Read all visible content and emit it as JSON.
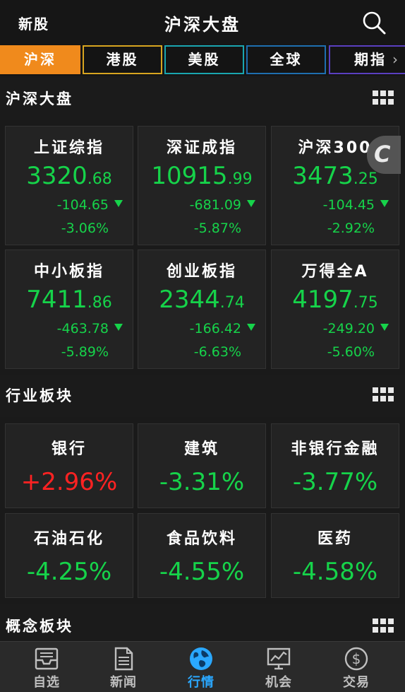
{
  "header": {
    "left": "新股",
    "title": "沪深大盘",
    "search_icon": "search-icon"
  },
  "tabs": [
    {
      "label": "沪深",
      "color": "#f08a1c",
      "active": true
    },
    {
      "label": "港股",
      "color": "#d8a520"
    },
    {
      "label": "美股",
      "color": "#1aa6b0"
    },
    {
      "label": "全球",
      "color": "#1e6fb0"
    },
    {
      "label": "期指",
      "color": "#5a3fc0"
    }
  ],
  "sections": {
    "index": "沪深大盘",
    "industry": "行业板块",
    "concept": "概念板块"
  },
  "indices": [
    {
      "name": "上证综指",
      "int": "3320",
      "dec": ".68",
      "chg": "-104.65",
      "pct": "-3.06%"
    },
    {
      "name": "深证成指",
      "int": "10915",
      "dec": ".99",
      "chg": "-681.09",
      "pct": "-5.87%"
    },
    {
      "name": "沪深300",
      "int": "3473",
      "dec": ".25",
      "chg": "-104.45",
      "pct": "-2.92%"
    },
    {
      "name": "中小板指",
      "int": "7411",
      "dec": ".86",
      "chg": "-463.78",
      "pct": "-5.89%"
    },
    {
      "name": "创业板指",
      "int": "2344",
      "dec": ".74",
      "chg": "-166.42",
      "pct": "-6.63%"
    },
    {
      "name": "万得全A",
      "int": "4197",
      "dec": ".75",
      "chg": "-249.20",
      "pct": "-5.60%"
    }
  ],
  "industries": [
    {
      "name": "银行",
      "pct": "+2.96%",
      "up": true
    },
    {
      "name": "建筑",
      "pct": "-3.31%"
    },
    {
      "name": "非银行金融",
      "pct": "-3.77%"
    },
    {
      "name": "石油石化",
      "pct": "-4.25%"
    },
    {
      "name": "食品饮料",
      "pct": "-4.55%"
    },
    {
      "name": "医药",
      "pct": "-4.58%"
    }
  ],
  "float_button": {
    "glyph": "C"
  },
  "nav": [
    {
      "label": "自选",
      "icon": "inbox-icon"
    },
    {
      "label": "新闻",
      "icon": "document-icon"
    },
    {
      "label": "行情",
      "icon": "globe-icon",
      "active": true
    },
    {
      "label": "机会",
      "icon": "chart-icon"
    },
    {
      "label": "交易",
      "icon": "dollar-icon"
    }
  ],
  "colors": {
    "up": "#ff2222",
    "down": "#16d34a",
    "active_nav": "#2aa8ff"
  }
}
